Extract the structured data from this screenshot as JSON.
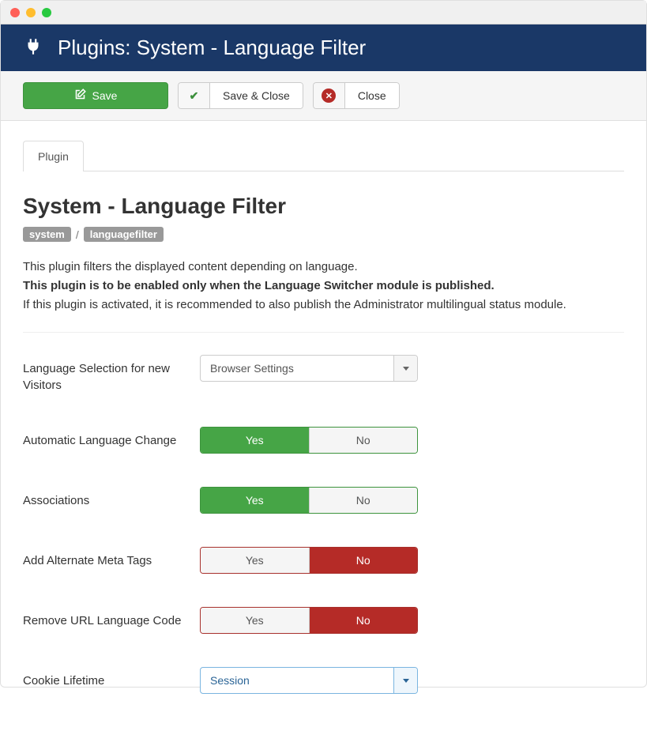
{
  "header": {
    "title": "Plugins: System - Language Filter"
  },
  "toolbar": {
    "save": "Save",
    "save_close": "Save & Close",
    "close": "Close"
  },
  "tabs": {
    "plugin": "Plugin"
  },
  "page": {
    "title": "System - Language Filter",
    "badge1": "system",
    "badge2": "languagefilter",
    "desc_line1": "This plugin filters the displayed content depending on language.",
    "desc_line2": "This plugin is to be enabled only when the Language Switcher module is published.",
    "desc_line3": "If this plugin is activated, it is recommended to also publish the Administrator multilingual status module."
  },
  "fields": {
    "lang_selection": {
      "label": "Language Selection for new Visitors",
      "value": "Browser Settings"
    },
    "auto_lang_change": {
      "label": "Automatic Language Change",
      "yes": "Yes",
      "no": "No",
      "selected": "yes"
    },
    "associations": {
      "label": "Associations",
      "yes": "Yes",
      "no": "No",
      "selected": "yes"
    },
    "alt_meta": {
      "label": "Add Alternate Meta Tags",
      "yes": "Yes",
      "no": "No",
      "selected": "no"
    },
    "remove_url_code": {
      "label": "Remove URL Language Code",
      "yes": "Yes",
      "no": "No",
      "selected": "no"
    },
    "cookie_lifetime": {
      "label": "Cookie Lifetime",
      "value": "Session"
    }
  }
}
